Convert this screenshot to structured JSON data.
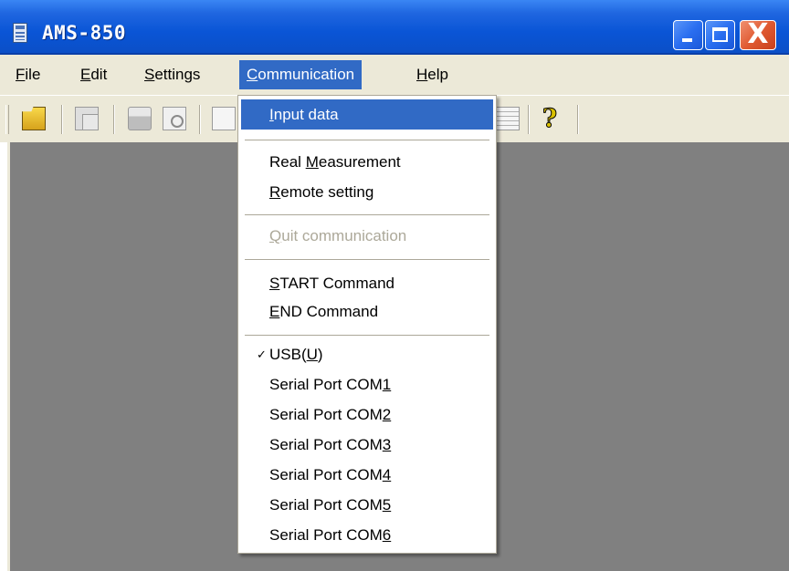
{
  "window": {
    "title": "AMS-850",
    "controls": {
      "minimize": "minimize",
      "maximize": "maximize",
      "close": "X"
    }
  },
  "menubar": {
    "items": [
      {
        "label_prefix": "",
        "mnemonic": "F",
        "label_suffix": "ile"
      },
      {
        "label_prefix": "",
        "mnemonic": "E",
        "label_suffix": "dit"
      },
      {
        "label_prefix": "",
        "mnemonic": "S",
        "label_suffix": "ettings"
      },
      {
        "label_prefix": "",
        "mnemonic": "C",
        "label_suffix": "ommunication"
      },
      {
        "label_prefix": "",
        "mnemonic": "H",
        "label_suffix": "elp"
      }
    ],
    "active_index": 3
  },
  "toolbar": {
    "icons": [
      "open-folder-icon",
      "copy-icon",
      "print-icon",
      "print-preview-icon",
      "document-icon",
      "list-view-icon",
      "help-icon"
    ],
    "help_glyph": "?"
  },
  "communication_menu": {
    "items": [
      {
        "pre": "",
        "m": "I",
        "post": "nput data",
        "state": "highlighted"
      },
      {
        "pre": "Real ",
        "m": "M",
        "post": "easurement",
        "state": "normal"
      },
      {
        "pre": "",
        "m": "R",
        "post": "emote setting",
        "state": "normal"
      },
      {
        "pre": "",
        "m": "Q",
        "post": "uit communication",
        "state": "disabled"
      },
      {
        "pre": "",
        "m": "S",
        "post": "TART Command",
        "state": "normal"
      },
      {
        "pre": "",
        "m": "E",
        "post": "ND Command",
        "state": "normal"
      },
      {
        "pre": "USB(",
        "m": "U",
        "post": ")",
        "state": "checked"
      },
      {
        "pre": "Serial Port COM",
        "m": "1",
        "post": "",
        "state": "normal"
      },
      {
        "pre": "Serial Port COM",
        "m": "2",
        "post": "",
        "state": "normal"
      },
      {
        "pre": "Serial Port COM",
        "m": "3",
        "post": "",
        "state": "normal"
      },
      {
        "pre": "Serial Port COM",
        "m": "4",
        "post": "",
        "state": "normal"
      },
      {
        "pre": "Serial Port COM",
        "m": "5",
        "post": "",
        "state": "normal"
      },
      {
        "pre": "Serial Port COM",
        "m": "6",
        "post": "",
        "state": "normal"
      }
    ],
    "check_glyph": "✓"
  },
  "colors": {
    "titlebar": "#0b4fc7",
    "menu_highlight": "#316ac5",
    "workspace": "#808080",
    "chrome": "#ece9d8"
  }
}
